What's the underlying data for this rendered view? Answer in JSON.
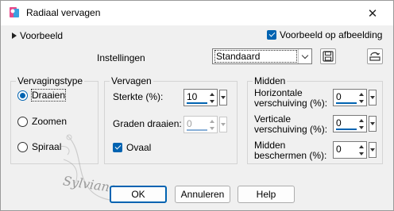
{
  "window": {
    "title": "Radiaal vervagen"
  },
  "preview": {
    "toggle_label": "Voorbeeld",
    "on_image_label": "Voorbeeld op afbeelding",
    "on_image_checked": true
  },
  "settings": {
    "label": "Instellingen",
    "preset_value": "Standaard"
  },
  "blur_type": {
    "title": "Vervagingstype",
    "options": [
      {
        "label": "Draaien",
        "selected": true
      },
      {
        "label": "Zoomen",
        "selected": false
      },
      {
        "label": "Spiraal",
        "selected": false
      }
    ]
  },
  "blur": {
    "title": "Vervagen",
    "strength_label": "Sterkte (%):",
    "strength_value": "10",
    "twist_label": "Graden draaien:",
    "twist_value": "0",
    "oval_label": "Ovaal",
    "oval_checked": true
  },
  "center": {
    "title": "Midden",
    "h_offset_label_1": "Horizontale",
    "h_offset_label_2": "verschuiving (%):",
    "h_offset_value": "0",
    "v_offset_label_1": "Verticale",
    "v_offset_label_2": "verschuiving (%):",
    "v_offset_value": "0",
    "protect_label_1": "Midden",
    "protect_label_2": "beschermen (%):",
    "protect_value": "0"
  },
  "buttons": {
    "ok": "OK",
    "cancel": "Annuleren",
    "help": "Help"
  },
  "watermark": {
    "text": "Sylviane"
  },
  "colors": {
    "accent": "#0063b1"
  }
}
